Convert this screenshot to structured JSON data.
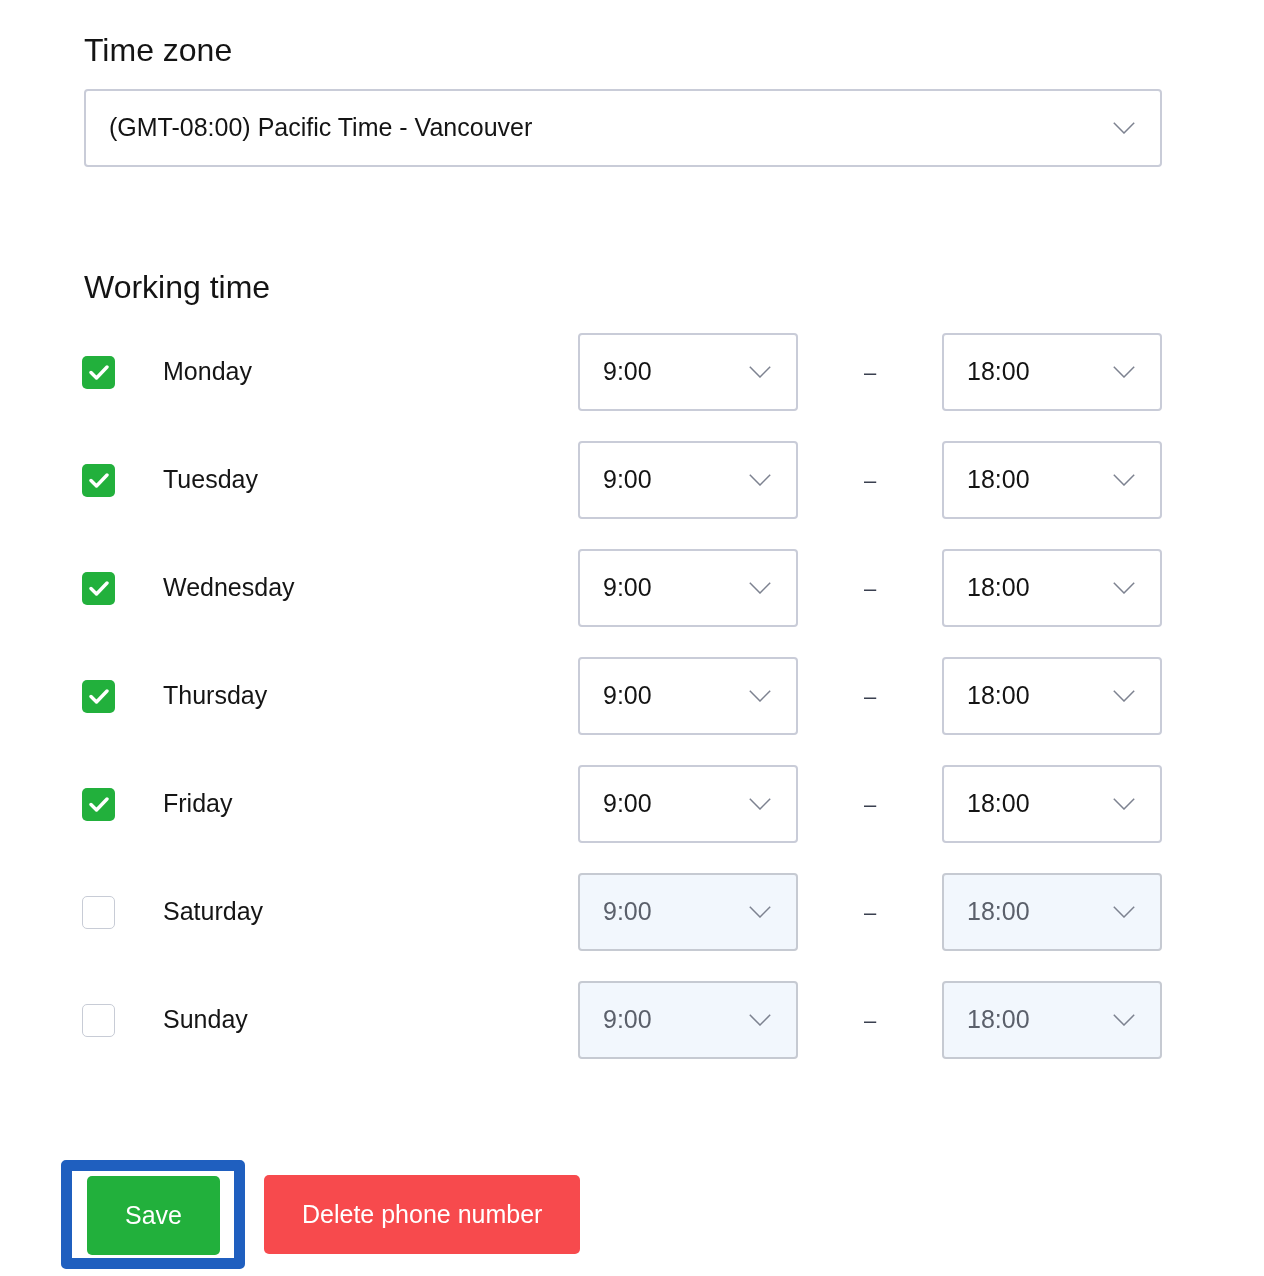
{
  "time_zone": {
    "label": "Time zone",
    "value": "(GMT-08:00) Pacific Time - Vancouver"
  },
  "working_time": {
    "title": "Working time",
    "days": [
      {
        "day": "Monday",
        "checked": true,
        "start": "9:00",
        "separator": "–",
        "end": "18:00"
      },
      {
        "day": "Tuesday",
        "checked": true,
        "start": "9:00",
        "separator": "–",
        "end": "18:00"
      },
      {
        "day": "Wednesday",
        "checked": true,
        "start": "9:00",
        "separator": "–",
        "end": "18:00"
      },
      {
        "day": "Thursday",
        "checked": true,
        "start": "9:00",
        "separator": "–",
        "end": "18:00"
      },
      {
        "day": "Friday",
        "checked": true,
        "start": "9:00",
        "separator": "–",
        "end": "18:00"
      },
      {
        "day": "Saturday",
        "checked": false,
        "start": "9:00",
        "separator": "–",
        "end": "18:00"
      },
      {
        "day": "Sunday",
        "checked": false,
        "start": "9:00",
        "separator": "–",
        "end": "18:00"
      }
    ]
  },
  "buttons": [
    {
      "kind": "save",
      "label": "Save",
      "focused": true
    },
    {
      "kind": "delete",
      "label": "Delete phone number",
      "focused": false
    }
  ]
}
